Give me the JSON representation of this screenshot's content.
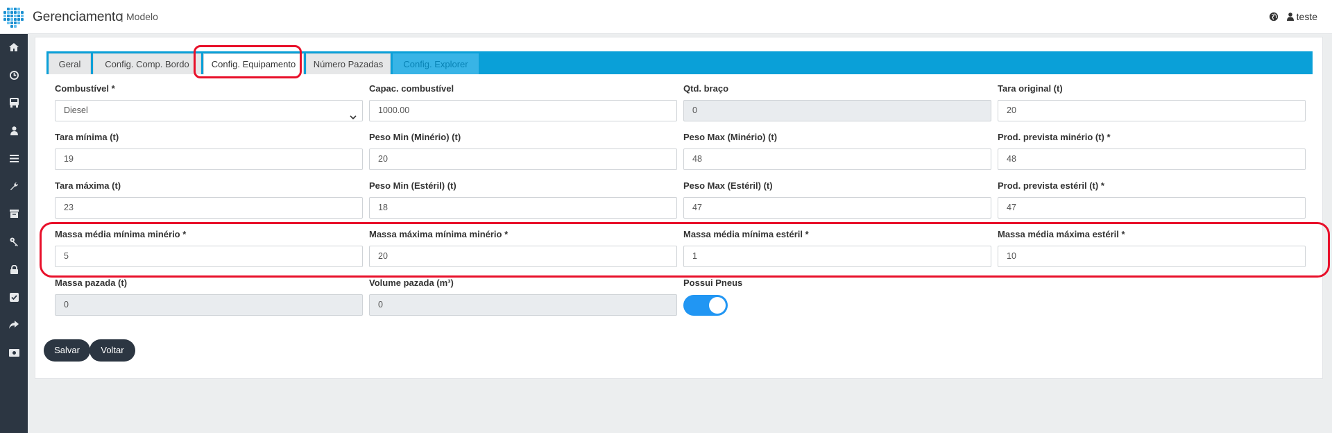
{
  "header": {
    "title": "Gerenciamento",
    "separator": "|",
    "subtitle": "Modelo",
    "user": "teste"
  },
  "sidebar": {
    "icons": [
      "home-icon",
      "clock-icon",
      "bus-icon",
      "user-icon",
      "menu-icon",
      "wrench-icon",
      "archive-icon",
      "key-icon",
      "lock-icon",
      "check-square-icon",
      "share-icon",
      "money-icon"
    ]
  },
  "tabs": [
    {
      "label": "Geral"
    },
    {
      "label": "Config. Comp. Bordo"
    },
    {
      "label": "Config. Equipamento"
    },
    {
      "label": "Número Pazadas"
    },
    {
      "label": "Config. Explorer"
    }
  ],
  "form": {
    "combustivel": {
      "label": "Combustível *",
      "value": "Diesel"
    },
    "capac_combustivel": {
      "label": "Capac. combustível",
      "value": "1000.00"
    },
    "qtd_braco": {
      "label": "Qtd. braço",
      "value": "0"
    },
    "tara_original": {
      "label": "Tara original (t)",
      "value": "20"
    },
    "tara_minima": {
      "label": "Tara mínima (t)",
      "value": "19"
    },
    "peso_min_minerio": {
      "label": "Peso Min (Minério) (t)",
      "value": "20"
    },
    "peso_max_minerio": {
      "label": "Peso Max (Minério) (t)",
      "value": "48"
    },
    "prod_prevista_minerio": {
      "label": "Prod. prevista minério (t) *",
      "value": "48"
    },
    "tara_maxima": {
      "label": "Tara máxima (t)",
      "value": "23"
    },
    "peso_min_esteril": {
      "label": "Peso Min (Estéril) (t)",
      "value": "18"
    },
    "peso_max_esteril": {
      "label": "Peso Max (Estéril) (t)",
      "value": "47"
    },
    "prod_prevista_esteril": {
      "label": "Prod. prevista estéril (t) *",
      "value": "47"
    },
    "massa_media_minima_minerio": {
      "label": "Massa média mínima minério *",
      "value": "5"
    },
    "massa_maxima_minima_minerio": {
      "label": "Massa máxima mínima minério *",
      "value": "20"
    },
    "massa_media_minima_esteril": {
      "label": "Massa média mínima estéril *",
      "value": "1"
    },
    "massa_media_maxima_esteril": {
      "label": "Massa média máxima estéril *",
      "value": "10"
    },
    "massa_pazada": {
      "label": "Massa pazada (t)",
      "value": "0"
    },
    "volume_pazada": {
      "label": "Volume pazada (m³)",
      "value": "0"
    },
    "possui_pneus": {
      "label": "Possui Pneus",
      "checked": true
    }
  },
  "buttons": {
    "save": "Salvar",
    "back": "Voltar"
  },
  "colors": {
    "tab_bar": "#0aa0d8",
    "sidebar": "#2c3642",
    "toggle_on": "#2196f3",
    "annotation": "#e8102a"
  }
}
